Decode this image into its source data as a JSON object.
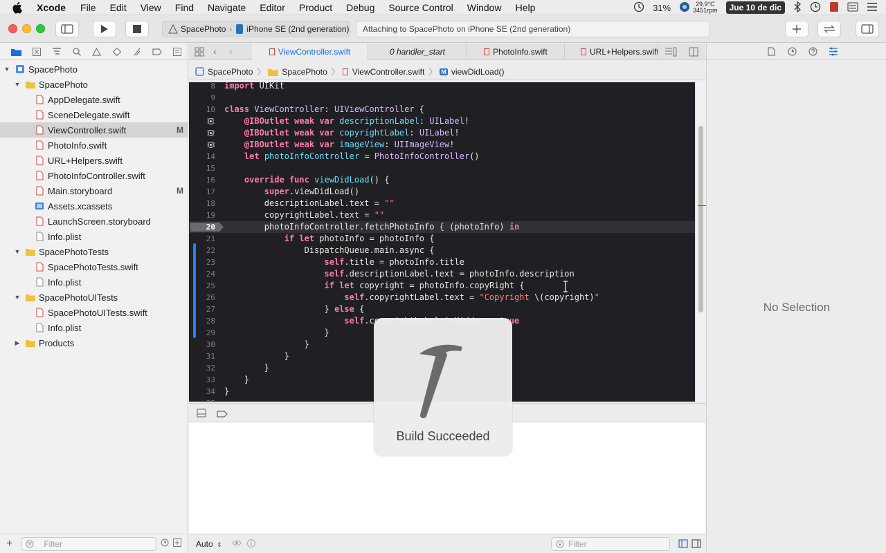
{
  "menubar": {
    "app_name": "Xcode",
    "items": [
      "File",
      "Edit",
      "View",
      "Find",
      "Navigate",
      "Editor",
      "Product",
      "Debug",
      "Source Control",
      "Window",
      "Help"
    ],
    "battery": "31%",
    "temp_line1": "29.9°C",
    "temp_line2": "3451rpm",
    "date": "Jue 10 de dic"
  },
  "toolbar": {
    "scheme_project": "SpacePhoto",
    "scheme_device": "iPhone SE (2nd generation)",
    "activity_text": "Attaching to SpacePhoto on iPhone SE (2nd generation)"
  },
  "navigator": {
    "tree": [
      {
        "label": "SpacePhoto",
        "kind": "project",
        "indent": 0,
        "expanded": true,
        "badge": ""
      },
      {
        "label": "SpacePhoto",
        "kind": "folder",
        "indent": 1,
        "expanded": true,
        "badge": ""
      },
      {
        "label": "AppDelegate.swift",
        "kind": "swift",
        "indent": 2,
        "badge": ""
      },
      {
        "label": "SceneDelegate.swift",
        "kind": "swift",
        "indent": 2,
        "badge": ""
      },
      {
        "label": "ViewController.swift",
        "kind": "swift",
        "indent": 2,
        "badge": "M",
        "selected": true
      },
      {
        "label": "PhotoInfo.swift",
        "kind": "swift",
        "indent": 2,
        "badge": ""
      },
      {
        "label": "URL+Helpers.swift",
        "kind": "swift",
        "indent": 2,
        "badge": ""
      },
      {
        "label": "PhotoInfoController.swift",
        "kind": "swift",
        "indent": 2,
        "badge": ""
      },
      {
        "label": "Main.storyboard",
        "kind": "storyboard",
        "indent": 2,
        "badge": "M"
      },
      {
        "label": "Assets.xcassets",
        "kind": "assets",
        "indent": 2,
        "badge": ""
      },
      {
        "label": "LaunchScreen.storyboard",
        "kind": "storyboard",
        "indent": 2,
        "badge": ""
      },
      {
        "label": "Info.plist",
        "kind": "plist",
        "indent": 2,
        "badge": ""
      },
      {
        "label": "SpacePhotoTests",
        "kind": "folder",
        "indent": 1,
        "expanded": true,
        "badge": ""
      },
      {
        "label": "SpacePhotoTests.swift",
        "kind": "swift",
        "indent": 2,
        "badge": ""
      },
      {
        "label": "Info.plist",
        "kind": "plist",
        "indent": 2,
        "badge": ""
      },
      {
        "label": "SpacePhotoUITests",
        "kind": "folder",
        "indent": 1,
        "expanded": true,
        "badge": ""
      },
      {
        "label": "SpacePhotoUITests.swift",
        "kind": "swift",
        "indent": 2,
        "badge": ""
      },
      {
        "label": "Info.plist",
        "kind": "plist",
        "indent": 2,
        "badge": ""
      },
      {
        "label": "Products",
        "kind": "folder",
        "indent": 1,
        "expanded": false,
        "badge": ""
      }
    ],
    "filter_placeholder": "Filter"
  },
  "tabs": [
    {
      "label": "ViewController.swift",
      "active": true,
      "italic": false
    },
    {
      "label": "0 handler_start",
      "active": false,
      "italic": true
    },
    {
      "label": "PhotoInfo.swift",
      "active": false,
      "italic": false
    },
    {
      "label": "URL+Helpers.swift",
      "active": false,
      "italic": false
    }
  ],
  "jumpbar": [
    "SpacePhoto",
    "SpacePhoto",
    "ViewController.swift",
    "viewDidLoad()"
  ],
  "code": [
    {
      "n": "8",
      "tokens": [
        [
          "kw",
          "import"
        ],
        [
          "",
          " UIKit"
        ]
      ]
    },
    {
      "n": "9",
      "tokens": []
    },
    {
      "n": "10",
      "tokens": [
        [
          "kw",
          "class"
        ],
        [
          "",
          " "
        ],
        [
          "ty",
          "ViewController"
        ],
        [
          "",
          ": "
        ],
        [
          "ty",
          "UIViewController"
        ],
        [
          "",
          " {"
        ]
      ]
    },
    {
      "n": "11",
      "bp": true,
      "tokens": [
        [
          "",
          "    "
        ],
        [
          "an",
          "@IBOutlet"
        ],
        [
          "",
          " "
        ],
        [
          "kw",
          "weak"
        ],
        [
          "",
          " "
        ],
        [
          "kw",
          "var"
        ],
        [
          "",
          " "
        ],
        [
          "pr",
          "descriptionLabel"
        ],
        [
          "",
          ": "
        ],
        [
          "ty",
          "UILabel"
        ],
        [
          "",
          "!"
        ]
      ]
    },
    {
      "n": "12",
      "bp": true,
      "tokens": [
        [
          "",
          "    "
        ],
        [
          "an",
          "@IBOutlet"
        ],
        [
          "",
          " "
        ],
        [
          "kw",
          "weak"
        ],
        [
          "",
          " "
        ],
        [
          "kw",
          "var"
        ],
        [
          "",
          " "
        ],
        [
          "pr",
          "copyrightLabel"
        ],
        [
          "",
          ": "
        ],
        [
          "ty",
          "UILabel"
        ],
        [
          "",
          "!"
        ]
      ]
    },
    {
      "n": "13",
      "bp": true,
      "tokens": [
        [
          "",
          "    "
        ],
        [
          "an",
          "@IBOutlet"
        ],
        [
          "",
          " "
        ],
        [
          "kw",
          "weak"
        ],
        [
          "",
          " "
        ],
        [
          "kw",
          "var"
        ],
        [
          "",
          " "
        ],
        [
          "pr",
          "imageView"
        ],
        [
          "",
          ": "
        ],
        [
          "ty",
          "UIImageView"
        ],
        [
          "",
          "!"
        ]
      ]
    },
    {
      "n": "14",
      "tokens": [
        [
          "",
          "    "
        ],
        [
          "kw",
          "let"
        ],
        [
          "",
          " "
        ],
        [
          "pr",
          "photoInfoController"
        ],
        [
          "",
          " = "
        ],
        [
          "ty",
          "PhotoInfoController"
        ],
        [
          "",
          "()"
        ]
      ]
    },
    {
      "n": "15",
      "tokens": []
    },
    {
      "n": "16",
      "tokens": [
        [
          "",
          "    "
        ],
        [
          "kw",
          "override"
        ],
        [
          "",
          " "
        ],
        [
          "kw",
          "func"
        ],
        [
          "",
          " "
        ],
        [
          "pr",
          "viewDidLoad"
        ],
        [
          "",
          "() {"
        ]
      ]
    },
    {
      "n": "17",
      "tokens": [
        [
          "",
          "        "
        ],
        [
          "kw",
          "super"
        ],
        [
          "",
          ".viewDidLoad()"
        ]
      ]
    },
    {
      "n": "18",
      "tokens": [
        [
          "",
          "        descriptionLabel.text = "
        ],
        [
          "st",
          "\"\""
        ]
      ]
    },
    {
      "n": "19",
      "tokens": [
        [
          "",
          "        copyrightLabel.text = "
        ],
        [
          "st",
          "\"\""
        ]
      ]
    },
    {
      "n": "20",
      "hl": true,
      "tokens": [
        [
          "",
          "        photoInfoController.fetchPhotoInfo { (photoInfo) "
        ],
        [
          "kw",
          "in"
        ]
      ]
    },
    {
      "n": "21",
      "tokens": [
        [
          "",
          "            "
        ],
        [
          "kw",
          "if"
        ],
        [
          "",
          " "
        ],
        [
          "kw",
          "let"
        ],
        [
          "",
          " photoInfo = photoInfo {"
        ]
      ]
    },
    {
      "n": "22",
      "tokens": [
        [
          "",
          "                DispatchQueue.main.async {"
        ]
      ]
    },
    {
      "n": "23",
      "tokens": [
        [
          "",
          "                    "
        ],
        [
          "kw",
          "self"
        ],
        [
          "",
          ".title = photoInfo.title"
        ]
      ]
    },
    {
      "n": "24",
      "tokens": [
        [
          "",
          "                    "
        ],
        [
          "kw",
          "self"
        ],
        [
          "",
          ".descriptionLabel.text = photoInfo.description"
        ]
      ]
    },
    {
      "n": "25",
      "tokens": [
        [
          "",
          "                    "
        ],
        [
          "kw",
          "if"
        ],
        [
          "",
          " "
        ],
        [
          "kw",
          "let"
        ],
        [
          "",
          " copyright = photoInfo.copyRight {"
        ]
      ]
    },
    {
      "n": "26",
      "tokens": [
        [
          "",
          "                        "
        ],
        [
          "kw",
          "self"
        ],
        [
          "",
          ".copyrightLabel.text = "
        ],
        [
          "st",
          "\"Copyright "
        ],
        [
          "",
          "\\(copyright)"
        ],
        [
          "st",
          "\""
        ]
      ]
    },
    {
      "n": "27",
      "tokens": [
        [
          "",
          "                    } "
        ],
        [
          "kw",
          "else"
        ],
        [
          "",
          " {"
        ]
      ]
    },
    {
      "n": "28",
      "tokens": [
        [
          "",
          "                        "
        ],
        [
          "kw",
          "self"
        ],
        [
          "",
          ".copyrightLabel.isHidden = "
        ],
        [
          "kw",
          "true"
        ]
      ]
    },
    {
      "n": "29",
      "tokens": [
        [
          "",
          "                    }"
        ]
      ]
    },
    {
      "n": "30",
      "tokens": [
        [
          "",
          "                }"
        ]
      ]
    },
    {
      "n": "31",
      "tokens": [
        [
          "",
          "            }"
        ]
      ]
    },
    {
      "n": "32",
      "tokens": [
        [
          "",
          "        }"
        ]
      ]
    },
    {
      "n": "33",
      "tokens": [
        [
          "",
          "    }"
        ]
      ]
    },
    {
      "n": "34",
      "tokens": [
        [
          "",
          "}"
        ]
      ]
    },
    {
      "n": "35",
      "tokens": []
    }
  ],
  "bottom": {
    "auto_label": "Auto",
    "filter_placeholder": "Filter"
  },
  "inspector": {
    "no_selection": "No Selection"
  },
  "hud": {
    "label": "Build Succeeded"
  },
  "colors": {
    "accent": "#1a6fe0",
    "editor_bg": "#1f1f24",
    "keyword": "#ff7ab2",
    "type": "#dabaff",
    "property": "#6bdfff",
    "string": "#ff8170"
  }
}
